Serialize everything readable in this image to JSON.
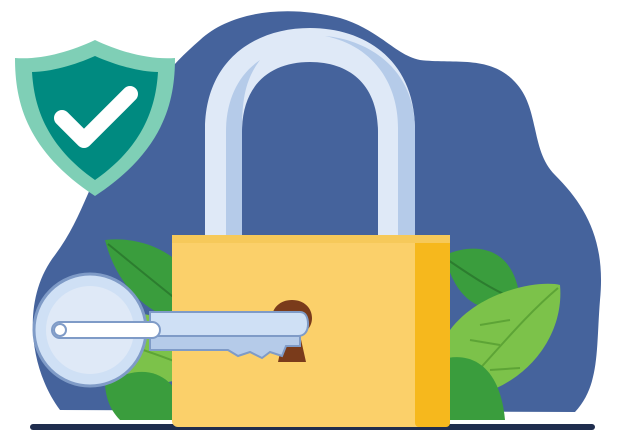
{
  "illustration": {
    "subject": "",
    "icons": [
      "shield-check-icon",
      "padlock-icon",
      "key-icon",
      "leaf-icon"
    ]
  },
  "colors": {
    "background": "#ffffff",
    "blob": "#45639c",
    "shield_outer": "#7fcfb6",
    "shield_inner": "#008a80",
    "check": "#ffffff",
    "shackle": "#dfe9f7",
    "shackle_shade": "#b5cbe9",
    "lock_body": "#fbd06a",
    "lock_body_shade": "#f6b81d",
    "keyhole": "#7a3b1b",
    "key": "#cfe0f5",
    "key_outline": "#7f9bc7",
    "leaf_dark": "#3a9d3d",
    "leaf_light": "#7cc24a",
    "ground": "#1f2d4e"
  }
}
